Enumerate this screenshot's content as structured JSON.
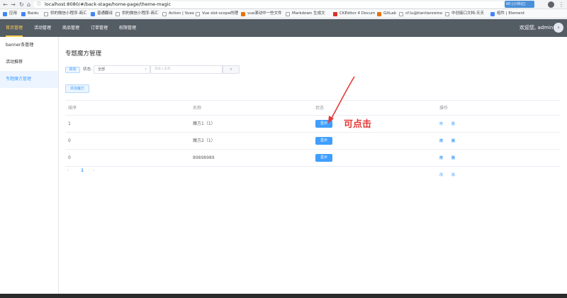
{
  "browser": {
    "url": "localhost:8080/#/back-stage/home-page/theme-magic",
    "bookmarks": [
      {
        "label": "应用",
        "icon": "apps-icon"
      },
      {
        "label": "Baidu",
        "icon": "paw-icon"
      },
      {
        "label": "供的微信小程序-商汇",
        "icon": "page-icon"
      },
      {
        "label": "普通翻译",
        "icon": "translate-icon"
      },
      {
        "label": "供的微信小程序-商汇",
        "icon": "page-icon"
      },
      {
        "label": "Action | Vuex",
        "icon": "page-icon"
      },
      {
        "label": "Vue slot-scope的理",
        "icon": "page-icon"
      },
      {
        "label": "vue滚动中一些文件",
        "icon": "page-icon"
      },
      {
        "label": "Markdown 生成文",
        "icon": "page-icon"
      },
      {
        "label": "CKEditor 4 Docum",
        "icon": "page-icon"
      },
      {
        "label": "GitLab",
        "icon": "gitlab-icon"
      },
      {
        "label": "cf.lu@tiantianremo",
        "icon": "mail-icon"
      },
      {
        "label": "中创接口文档-天天",
        "icon": "page-icon"
      },
      {
        "label": "组件 | Element",
        "icon": "element-icon"
      }
    ],
    "ext_badge": "00 [小帅记]"
  },
  "header": {
    "menu": [
      {
        "label": "首页管理",
        "active": true
      },
      {
        "label": "活动管理",
        "active": false
      },
      {
        "label": "商品管理",
        "active": false
      },
      {
        "label": "订单管理",
        "active": false
      },
      {
        "label": "权限管理",
        "active": false
      }
    ],
    "welcome": "欢迎您, admin"
  },
  "sidebar": {
    "items": [
      {
        "label": "banner条管理",
        "active": false
      },
      {
        "label": "活动推荐",
        "active": false
      },
      {
        "label": "专题魔方管理",
        "active": true
      }
    ]
  },
  "main": {
    "title": "专题魔方管理",
    "filter": {
      "tag": "启动",
      "status_label": "状态:",
      "select_value": "全部",
      "search_placeholder": "请录入名称"
    },
    "add_button": "添加魔方",
    "table": {
      "columns": [
        "排序",
        "名称",
        "状态",
        "操作"
      ],
      "rows": [
        {
          "order": "1",
          "name": "魔方1（1）",
          "status": "显示",
          "ops": [
            "修改",
            "删除"
          ]
        },
        {
          "order": "0",
          "name": "魔方2（1）",
          "status": "显示",
          "ops": [
            "修改",
            "删除"
          ]
        },
        {
          "order": "0",
          "name": "89898989",
          "status": "显示",
          "ops": [
            "修改",
            "删除"
          ]
        }
      ]
    },
    "pager": {
      "prev": "‹",
      "current": "1",
      "next": "›"
    }
  },
  "annotation": {
    "text": "可点击",
    "color": "#e53935"
  },
  "colors": {
    "header_bg": "#545c64",
    "accent": "#409eff",
    "active_menu": "#ffd04b"
  }
}
